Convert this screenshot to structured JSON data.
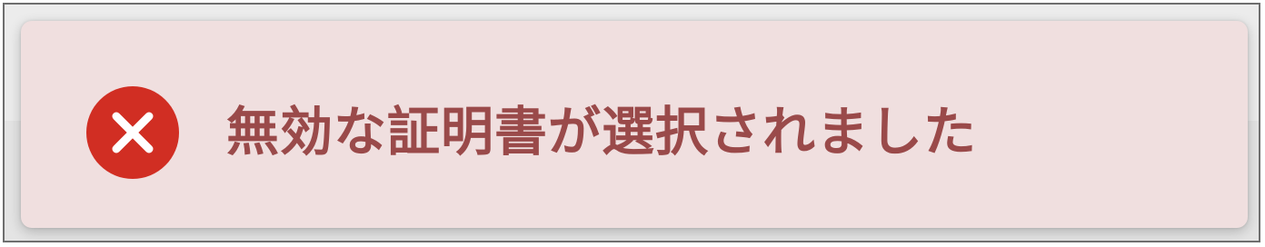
{
  "toast": {
    "type": "error",
    "icon": "error-x-circle-icon",
    "message": "無効な証明書が選択されました"
  },
  "colors": {
    "toast_background": "#f0dfdf",
    "icon_background": "#d12e23",
    "icon_foreground": "#ffffff",
    "message_text": "#9a4a4a"
  }
}
